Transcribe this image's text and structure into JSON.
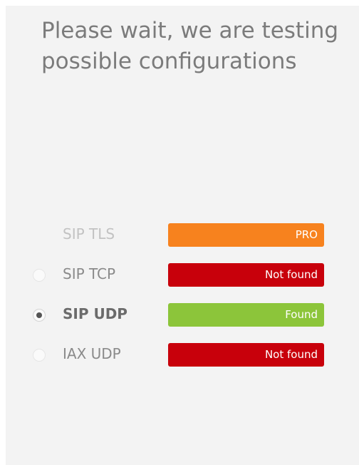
{
  "heading": "Please wait, we are testing possible configurations",
  "configurations": [
    {
      "protocol": "SIP TLS",
      "status": "PRO",
      "status_color": "#f7821e",
      "selected": false,
      "available": false
    },
    {
      "protocol": "SIP TCP",
      "status": "Not found",
      "status_color": "#c8000b",
      "selected": false,
      "available": true
    },
    {
      "protocol": "SIP UDP",
      "status": "Found",
      "status_color": "#8cc53a",
      "selected": true,
      "available": true
    },
    {
      "protocol": "IAX UDP",
      "status": "Not found",
      "status_color": "#c8000b",
      "selected": false,
      "available": true
    }
  ]
}
